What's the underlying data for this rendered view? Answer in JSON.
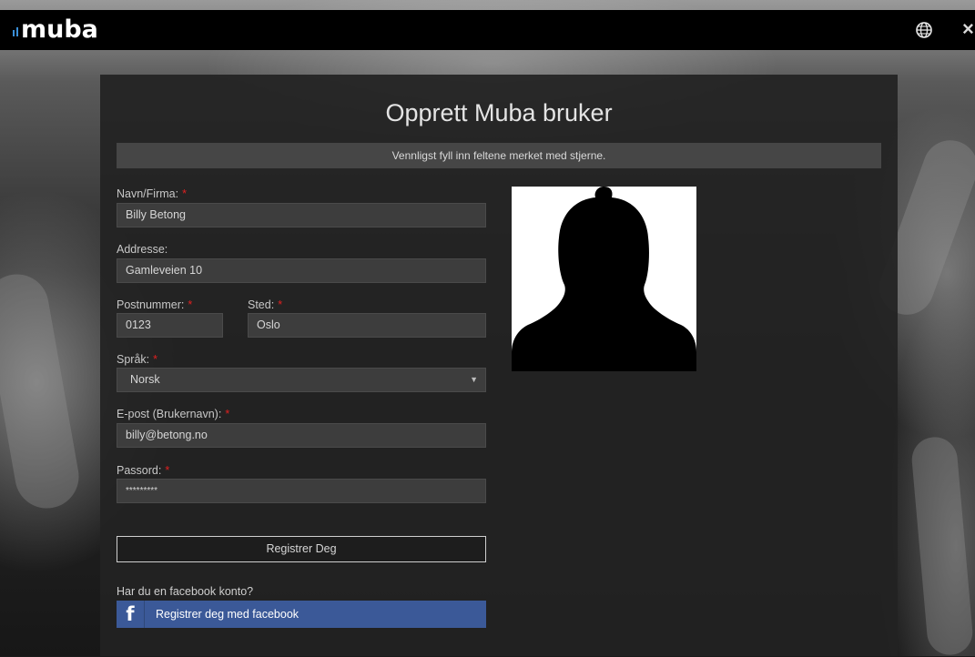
{
  "header": {
    "logo_text": "muba",
    "globe_icon": "globe-icon",
    "close_glyph": "×"
  },
  "form": {
    "title": "Opprett Muba bruker",
    "notice": "Vennligst fyll inn feltene merket med stjerne.",
    "required_mark": "*",
    "name": {
      "label": "Navn/Firma:",
      "value": "Billy Betong",
      "required": true
    },
    "address": {
      "label": "Addresse:",
      "value": "Gamleveien 10",
      "required": false
    },
    "postal": {
      "label": "Postnummer:",
      "value": "0123",
      "required": true
    },
    "city": {
      "label": "Sted:",
      "value": "Oslo",
      "required": true
    },
    "language": {
      "label": "Språk:",
      "value": "Norsk",
      "required": true
    },
    "email": {
      "label": "E-post (Brukernavn):",
      "value": "billy@betong.no",
      "required": true
    },
    "password": {
      "label": "Passord:",
      "value": "*********",
      "required": true
    },
    "register_button": "Registrer Deg",
    "facebook_question": "Har du en facebook konto?",
    "facebook_button": "Registrer deg med facebook",
    "facebook_icon": "f"
  },
  "colors": {
    "accent_red": "#e02020",
    "facebook_blue": "#3b5998",
    "logo_bars": "#3a8fd8"
  }
}
